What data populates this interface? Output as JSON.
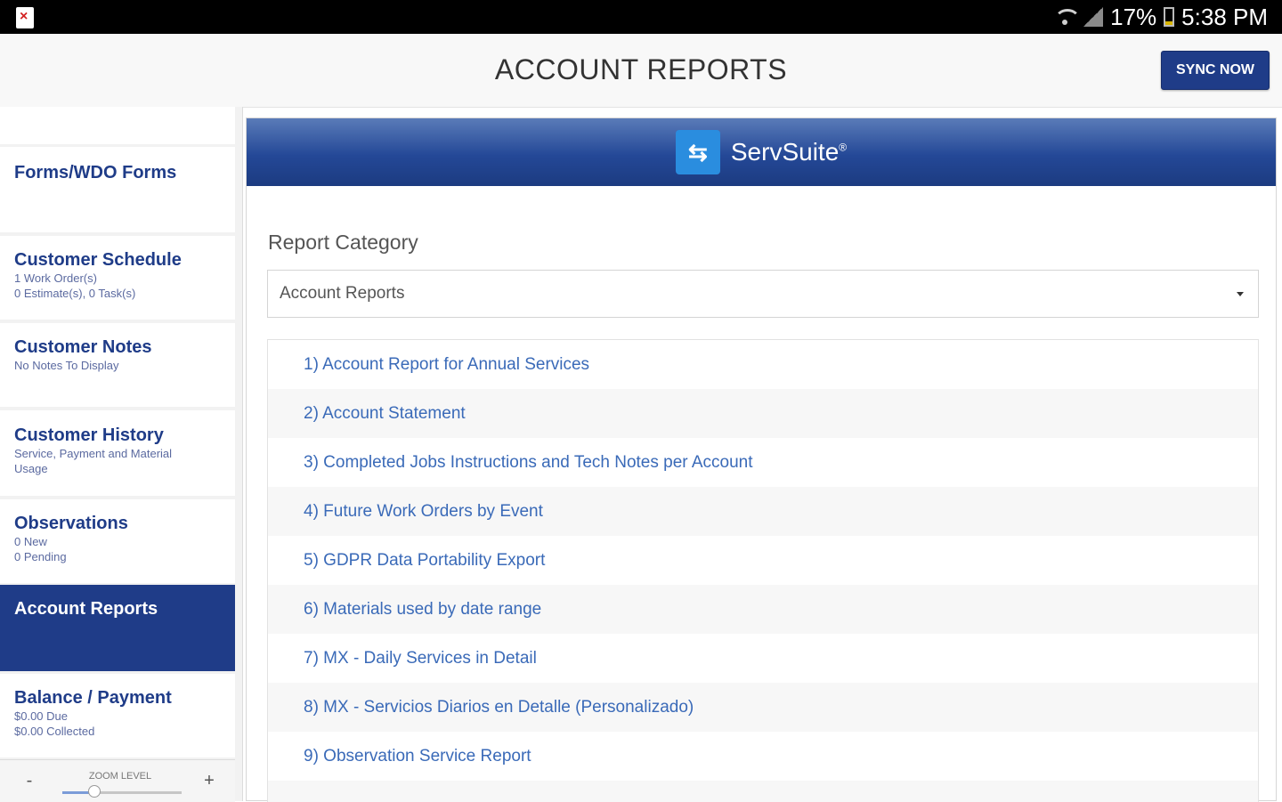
{
  "status_bar": {
    "battery": "17%",
    "time": "5:38 PM"
  },
  "header": {
    "title": "ACCOUNT REPORTS",
    "sync_label": "SYNC NOW"
  },
  "sidebar": {
    "items": [
      {
        "label": "Forms/WDO Forms",
        "sub1": "",
        "sub2": ""
      },
      {
        "label": "Customer Schedule",
        "sub1": "1 Work Order(s)",
        "sub2": "0 Estimate(s), 0 Task(s)"
      },
      {
        "label": "Customer Notes",
        "sub1": "No Notes To Display",
        "sub2": ""
      },
      {
        "label": "Customer History",
        "sub1": "Service, Payment and Material",
        "sub2": "Usage"
      },
      {
        "label": "Observations",
        "sub1": "0 New",
        "sub2": "0 Pending"
      },
      {
        "label": "Account Reports",
        "sub1": "",
        "sub2": ""
      },
      {
        "label": "Balance / Payment",
        "sub1": "$0.00 Due",
        "sub2": "$0.00 Collected"
      }
    ],
    "zoom": {
      "label": "ZOOM LEVEL",
      "minus": "-",
      "plus": "+",
      "level": 0.27
    }
  },
  "brand": {
    "name": "ServSuite",
    "mark": "®"
  },
  "report_category": {
    "label": "Report Category",
    "selected": "Account Reports"
  },
  "reports": [
    "1) Account Report for Annual Services",
    "2) Account Statement",
    "3) Completed Jobs Instructions and Tech Notes per Account",
    "4) Future Work Orders by Event",
    "5) GDPR Data Portability Export",
    "6) Materials used by date range",
    "7) MX - Daily Services in Detail",
    "8) MX - Servicios Diarios en Detalle (Personalizado)",
    "9) Observation Service Report"
  ]
}
